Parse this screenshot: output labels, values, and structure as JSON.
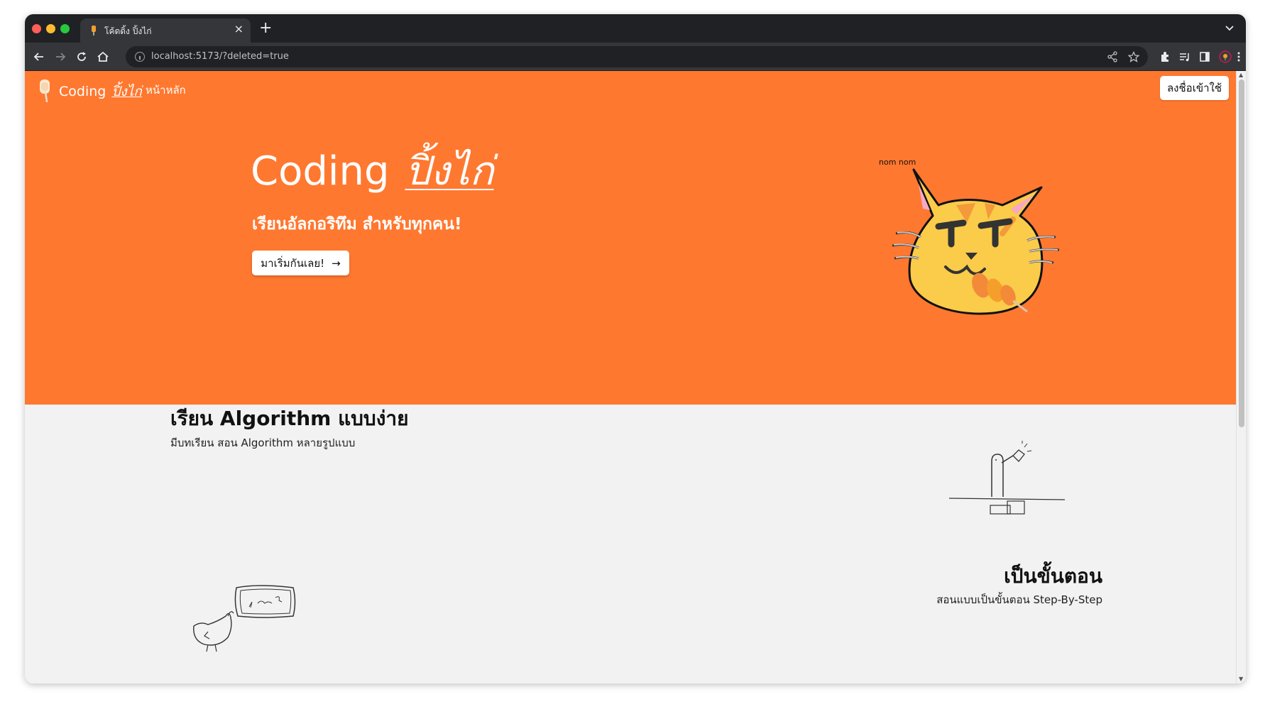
{
  "browser": {
    "tab_title": "โค้ดดิ้ง ปิ้งไก่",
    "tab_close": "×",
    "new_tab": "+",
    "url": "localhost:5173/?deleted=true",
    "icons": [
      "back-icon",
      "forward-icon",
      "reload-icon",
      "home-icon",
      "info-icon",
      "share-icon",
      "star-icon",
      "extensions-icon",
      "media-icon",
      "sidebar-icon",
      "profile-icon",
      "menu-icon"
    ]
  },
  "site": {
    "logo_text": "Coding",
    "logo_thai": "ปิ้งไก่",
    "nav_home": "หน้าหลัก",
    "login": "ลงชื่อเข้าใช้"
  },
  "hero": {
    "title": "Coding",
    "title_thai": "ปิ้งไก่",
    "subtitle": "เรียนอัลกอริทึม สำหรับทุกคน!",
    "cta": "มาเริ่มกันเลย!",
    "cta_arrow": "→",
    "nomnom": "nom nom"
  },
  "features": [
    {
      "title": "เรียน Algorithm แบบง่าย",
      "desc": "มีบทเรียน สอน Algorithm หลายรูปแบบ"
    },
    {
      "title": "เป็นขั้นตอน",
      "desc": "สอนแบบเป็นขั้นตอน Step-By-Step"
    }
  ],
  "colors": {
    "brand_orange": "#ff7830",
    "page_bg": "#f2f2f2",
    "cat_yellow": "#fbcb4a"
  }
}
